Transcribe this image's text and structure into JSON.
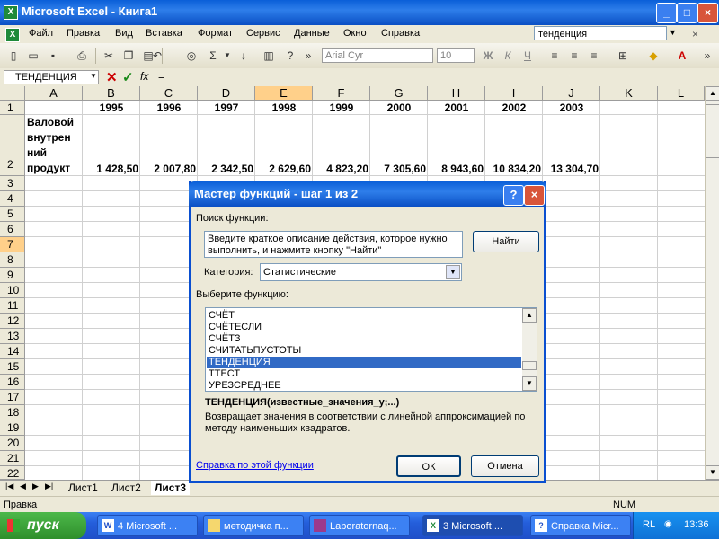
{
  "window": {
    "title": "Microsoft Excel - Книга1"
  },
  "menu": {
    "items": [
      "Файл",
      "Правка",
      "Вид",
      "Вставка",
      "Формат",
      "Сервис",
      "Данные",
      "Окно",
      "Справка"
    ]
  },
  "help_box": "тенденция",
  "toolbar": {
    "font": "Arial Cyr",
    "size": "10"
  },
  "formula_bar": {
    "name_box": "ТЕНДЕНЦИЯ",
    "fx": "fx",
    "eq": "="
  },
  "columns": [
    "A",
    "B",
    "C",
    "D",
    "E",
    "F",
    "G",
    "H",
    "I",
    "J",
    "K",
    "L"
  ],
  "rows": [
    "1",
    "2",
    "3",
    "4",
    "5",
    "6",
    "7",
    "8",
    "9",
    "10",
    "11",
    "12",
    "13",
    "14",
    "15",
    "16",
    "17",
    "18",
    "19",
    "20",
    "21",
    "22"
  ],
  "sheet": {
    "years": [
      "1995",
      "1996",
      "1997",
      "1998",
      "1999",
      "2000",
      "2001",
      "2002",
      "2003"
    ],
    "row2_label": [
      "Валовой",
      "внутрен",
      "ний",
      "продукт"
    ],
    "values": [
      "1 428,50",
      "2 007,80",
      "2 342,50",
      "2 629,60",
      "4 823,20",
      "7 305,60",
      "8 943,60",
      "10 834,20",
      "13 304,70"
    ]
  },
  "sheet_tabs": [
    "Лист1",
    "Лист2",
    "Лист3"
  ],
  "status": {
    "left": "Правка",
    "num": "NUM"
  },
  "dialog": {
    "title": "Мастер функций - шаг 1 из 2",
    "search_label": "Поиск функции:",
    "search_text": "Введите краткое описание действия, которое нужно выполнить, и нажмите кнопку \"Найти\"",
    "find_button": "Найти",
    "category_label": "Категория:",
    "category_value": "Статистические",
    "select_label": "Выберите функцию:",
    "functions": [
      "СЧЁТ",
      "СЧЁТЕСЛИ",
      "СЧЁТЗ",
      "СЧИТАТЬПУСТОТЫ",
      "ТЕНДЕНЦИЯ",
      "ТТЕСТ",
      "УРЕЗСРЕДНЕЕ"
    ],
    "selected_function": "ТЕНДЕНЦИЯ",
    "signature": "ТЕНДЕНЦИЯ(известные_значения_y;...)",
    "description": "Возвращает значения в соответствии с линейной аппроксимацией по методу наименьших квадратов.",
    "help_link": "Справка по этой функции",
    "ok": "ОК",
    "cancel": "Отмена"
  },
  "taskbar": {
    "start": "пуск",
    "tasks": [
      "4 Microsoft ...",
      "методичка п...",
      "Laboratornaq...",
      "3 Microsoft ...",
      "Справка Micr..."
    ],
    "lang": "RL",
    "clock": "13:36"
  }
}
